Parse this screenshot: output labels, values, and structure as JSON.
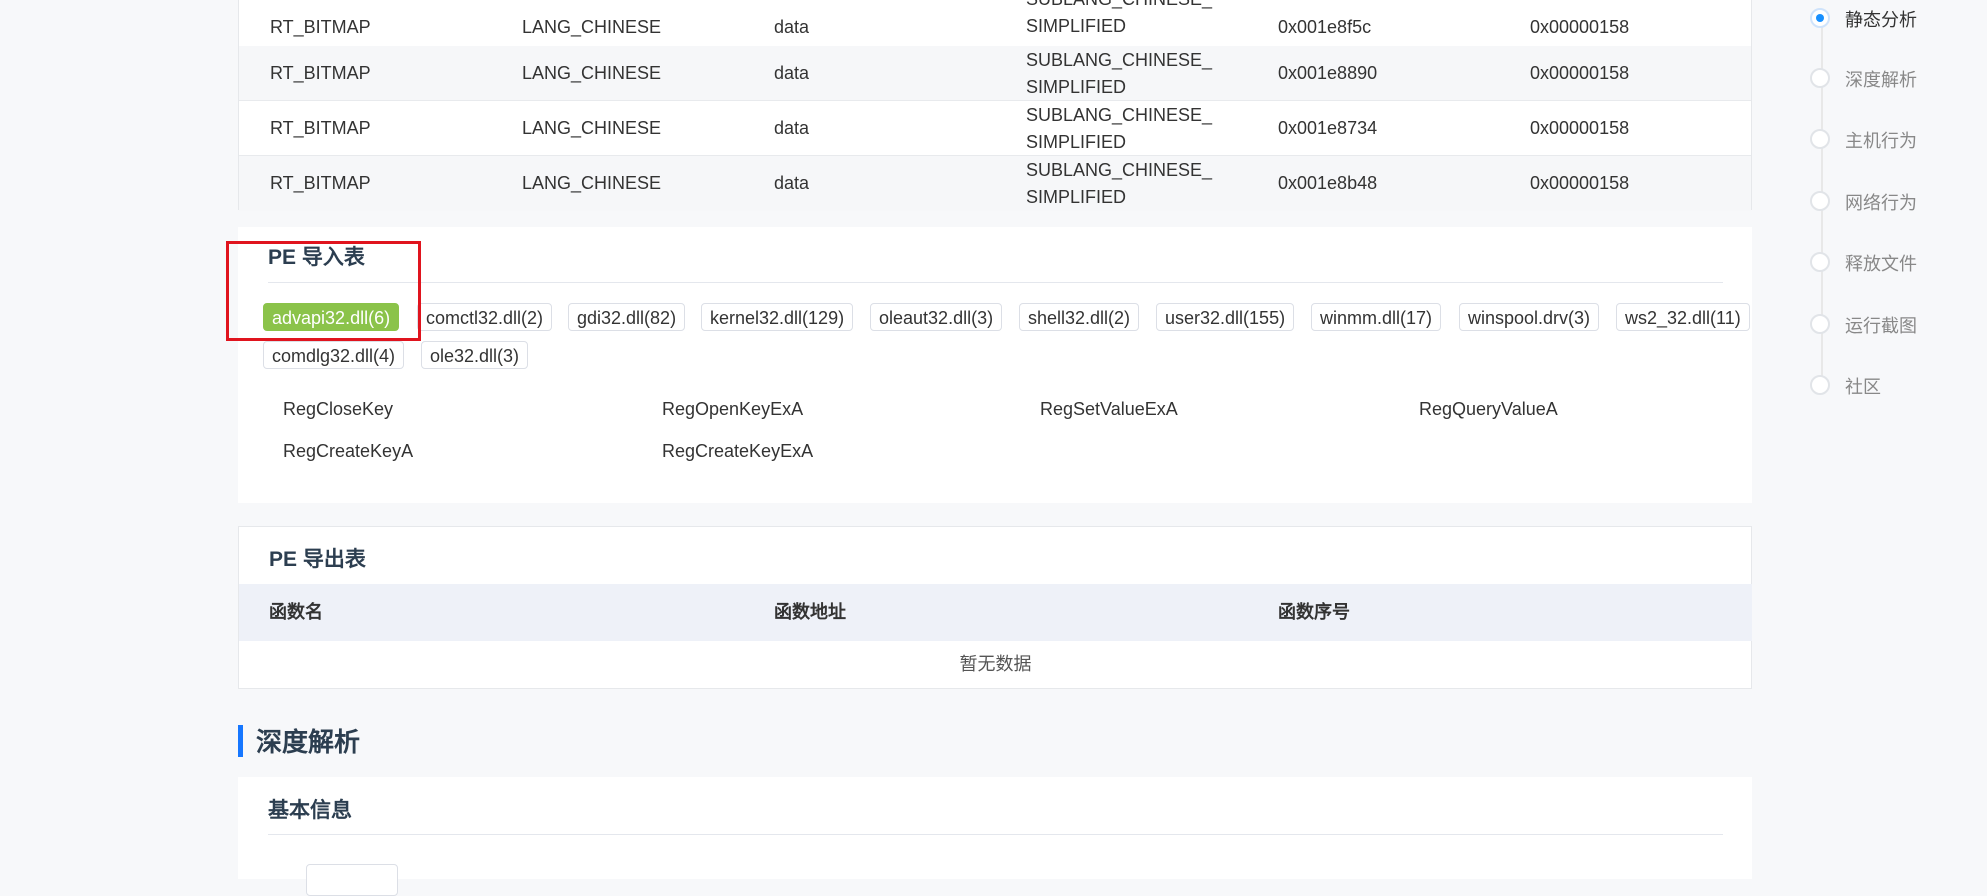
{
  "resource_table": {
    "rows": [
      {
        "type": "RT_BITMAP",
        "lang": "LANG_CHINESE",
        "kind": "data",
        "sublang_1": "SUBLANG_CHINESE_",
        "sublang_2": "SIMPLIFIED",
        "offset": "0x001e8f5c",
        "size": "0x00000158"
      },
      {
        "type": "RT_BITMAP",
        "lang": "LANG_CHINESE",
        "kind": "data",
        "sublang_1": "SUBLANG_CHINESE_",
        "sublang_2": "SIMPLIFIED",
        "offset": "0x001e8890",
        "size": "0x00000158"
      },
      {
        "type": "RT_BITMAP",
        "lang": "LANG_CHINESE",
        "kind": "data",
        "sublang_1": "SUBLANG_CHINESE_",
        "sublang_2": "SIMPLIFIED",
        "offset": "0x001e8734",
        "size": "0x00000158"
      },
      {
        "type": "RT_BITMAP",
        "lang": "LANG_CHINESE",
        "kind": "data",
        "sublang_1": "SUBLANG_CHINESE_",
        "sublang_2": "SIMPLIFIED",
        "offset": "0x001e8b48",
        "size": "0x00000158"
      }
    ]
  },
  "import_table": {
    "title": "PE 导入表",
    "tags": [
      "advapi32.dll(6)",
      "comctl32.dll(2)",
      "gdi32.dll(82)",
      "kernel32.dll(129)",
      "oleaut32.dll(3)",
      "shell32.dll(2)",
      "user32.dll(155)",
      "winmm.dll(17)",
      "winspool.drv(3)",
      "ws2_32.dll(11)",
      "comdlg32.dll(4)",
      "ole32.dll(3)"
    ],
    "active_tag_index": 0,
    "functions": [
      "RegCloseKey",
      "RegOpenKeyExA",
      "RegSetValueExA",
      "RegQueryValueA",
      "RegCreateKeyA",
      "RegCreateKeyExA"
    ]
  },
  "export_table": {
    "title": "PE 导出表",
    "columns": [
      "函数名",
      "函数地址",
      "函数序号"
    ],
    "empty_text": "暂无数据"
  },
  "deep_analysis": {
    "title": "深度解析",
    "basic_info_title": "基本信息"
  },
  "side_nav": {
    "items": [
      "静态分析",
      "深度解析",
      "主机行为",
      "网络行为",
      "释放文件",
      "运行截图",
      "社区"
    ],
    "active_index": 0
  },
  "colors": {
    "accent": "#1890ff",
    "active_tag": "#8bc34a",
    "highlight_box": "#e0141e",
    "section_bar": "#1677ff"
  }
}
